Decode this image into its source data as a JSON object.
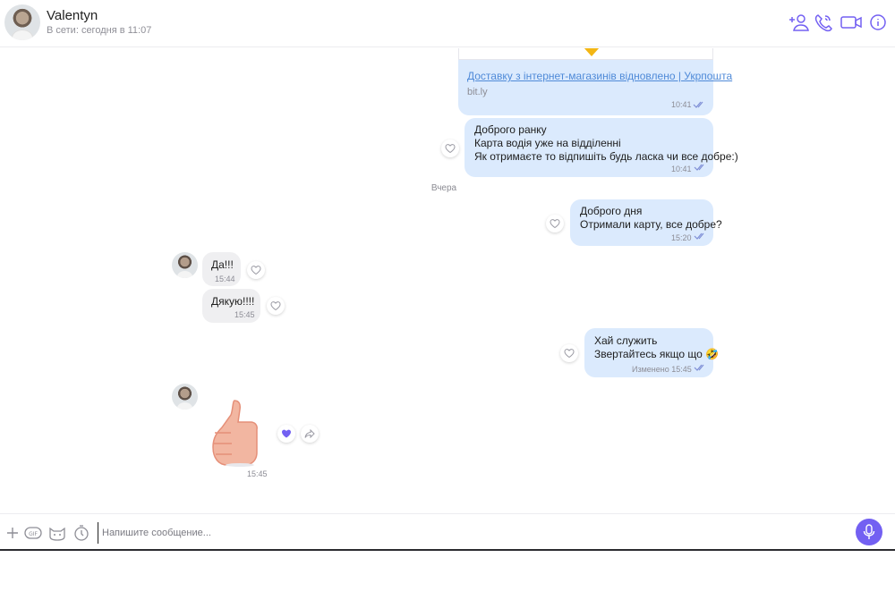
{
  "header": {
    "contact_name": "Valentyn",
    "status": "В сети: сегодня в 11:07",
    "icons": [
      "add-participant-icon",
      "phone-icon",
      "video-call-icon",
      "info-icon"
    ]
  },
  "colors": {
    "accent": "#7360f2",
    "outgoing_bubble": "#dbeafd",
    "incoming_bubble": "#efeff1",
    "link": "#4f8ad8"
  },
  "messages": {
    "link_card": {
      "title": "Доставку з інтернет-магазинів відновлено | Укрпошта",
      "domain": "bit.ly",
      "time": "10:41"
    },
    "morning": {
      "lines": [
        "Доброго ранку",
        "Карта водія уже на відділенні",
        "Як отримаєте то відпишіть будь ласка чи все добре:)"
      ],
      "time": "10:41"
    },
    "date_separator": "Вчера",
    "good_day": {
      "lines": [
        "Доброго дня",
        "Отримали карту, все добре?"
      ],
      "time": "15:20"
    },
    "yes": {
      "text": "Да!!!",
      "time": "15:44"
    },
    "thanks": {
      "text": "Дякую!!!!",
      "time": "15:45"
    },
    "service": {
      "lines": [
        "Хай служить",
        "Звертайтесь якщо що 🤣"
      ],
      "time": "Изменено 15:45"
    },
    "sticker": {
      "icon": "thumbs-up-sticker",
      "time": "15:45"
    }
  },
  "composer": {
    "placeholder": "Напишите сообщение...",
    "value": "",
    "icons": [
      "plus-icon",
      "gif-icon",
      "sticker-icon",
      "timer-icon",
      "microphone-icon"
    ]
  }
}
